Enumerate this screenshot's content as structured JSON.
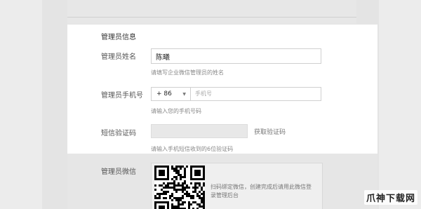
{
  "section_title": "管理员信息",
  "name": {
    "label": "管理员姓名",
    "value": "陈曦",
    "help": "请填写企业微信管理员的姓名"
  },
  "phone": {
    "label": "管理员手机号",
    "country_code": "+ 86",
    "placeholder": "手机号",
    "help": "请输入您的手机号码"
  },
  "sms": {
    "label": "短信验证码",
    "value": "",
    "button": "获取验证码",
    "help": "请输入手机短信收到的6位验证码"
  },
  "wechat": {
    "label": "管理员微信",
    "qr_text": "扫码绑定微信，创建完成后请用此微信登录管理后台"
  },
  "watermark": "爪神下载网",
  "colors": {
    "card": "#ffffff",
    "background": "#d9d9d9"
  }
}
